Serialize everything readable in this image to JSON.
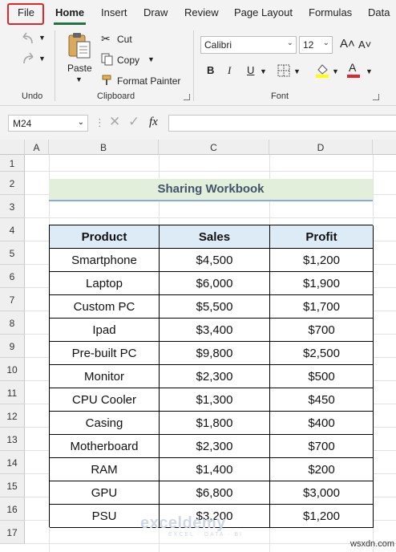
{
  "tabs": [
    "File",
    "Home",
    "Insert",
    "Draw",
    "Review",
    "Page Layout",
    "Formulas",
    "Data"
  ],
  "ribbon": {
    "undo_label": "Undo",
    "paste_label": "Paste",
    "cut_label": "Cut",
    "copy_label": "Copy",
    "format_painter_label": "Format Painter",
    "clipboard_label": "Clipboard",
    "font_name": "Calibri",
    "font_size": "12",
    "font_label": "Font",
    "bold": "B",
    "italic": "I",
    "underline": "U",
    "grow_font": "A˄",
    "shrink_font": "A˅"
  },
  "formula_bar": {
    "name_box": "M24",
    "fx": "fx",
    "formula": ""
  },
  "columns": [
    "A",
    "B",
    "C",
    "D"
  ],
  "rows": [
    "1",
    "2",
    "3",
    "4",
    "5",
    "6",
    "7",
    "8",
    "9",
    "10",
    "11",
    "12",
    "13",
    "14",
    "15",
    "16",
    "17"
  ],
  "sheet": {
    "title": "Sharing Workbook",
    "headers": [
      "Product",
      "Sales",
      "Profit"
    ],
    "data": [
      [
        "Smartphone",
        "$4,500",
        "$1,200"
      ],
      [
        "Laptop",
        "$6,000",
        "$1,900"
      ],
      [
        "Custom PC",
        "$5,500",
        "$1,700"
      ],
      [
        "Ipad",
        "$3,400",
        "$700"
      ],
      [
        "Pre-built PC",
        "$9,800",
        "$2,500"
      ],
      [
        "Monitor",
        "$2,300",
        "$500"
      ],
      [
        "CPU Cooler",
        "$1,300",
        "$450"
      ],
      [
        "Casing",
        "$1,800",
        "$400"
      ],
      [
        "Motherboard",
        "$2,300",
        "$700"
      ],
      [
        "RAM",
        "$1,400",
        "$200"
      ],
      [
        "GPU",
        "$6,800",
        "$3,000"
      ],
      [
        "PSU",
        "$3,200",
        "$1,200"
      ]
    ]
  },
  "watermark": {
    "name": "exceldemy",
    "tagline": "EXCEL · DATA · BI"
  },
  "credit": "wsxdn.com",
  "colors": {
    "accent": "#217346",
    "file_highlight": "#e0262c",
    "title_fill": "#e2efda",
    "header_fill": "#ddebf7"
  }
}
